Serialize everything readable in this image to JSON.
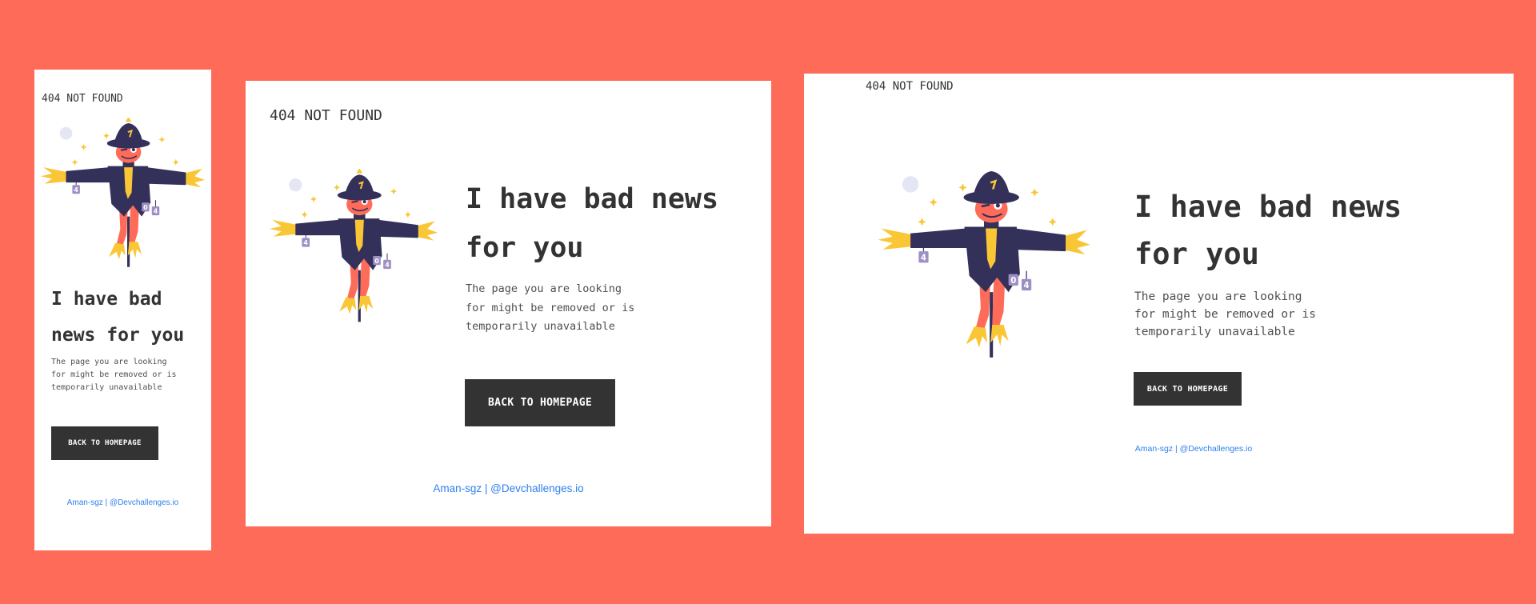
{
  "colors": {
    "background": "#ff6b59",
    "card": "#ffffff",
    "text": "#333333",
    "button": "#333333",
    "button_text": "#ffffff",
    "link": "#2f80ed"
  },
  "cards": [
    {
      "logo": "404 NOT FOUND",
      "headline_line1": "I have bad",
      "headline_line2": "news for you",
      "desc_line1": "The page you are looking",
      "desc_line2": "for might be removed or is",
      "desc_line3": "temporarily unavailable",
      "button_label": "BACK TO HOMEPAGE",
      "footer_author": "Aman-sgz",
      "footer_separator": "|",
      "footer_site": "@Devchallenges.io",
      "illustration_icon": "scarecrow-icon",
      "sign_letters": [
        "4",
        "0",
        "4"
      ]
    },
    {
      "logo": "404 NOT FOUND",
      "headline_line1": "I have bad news",
      "headline_line2": "for you",
      "desc_line1": "The page you are looking",
      "desc_line2": "for might be removed or is",
      "desc_line3": "temporarily unavailable",
      "button_label": "BACK TO HOMEPAGE",
      "footer_author": "Aman-sgz",
      "footer_separator": "|",
      "footer_site": "@Devchallenges.io",
      "illustration_icon": "scarecrow-icon",
      "sign_letters": [
        "4",
        "0",
        "4"
      ]
    },
    {
      "logo": "404 NOT FOUND",
      "headline_line1": "I have bad news",
      "headline_line2": "for you",
      "desc_line1": "The page you are looking",
      "desc_line2": "for might be removed or is",
      "desc_line3": "temporarily unavailable",
      "button_label": "BACK TO HOMEPAGE",
      "footer_author": "Aman-sgz",
      "footer_separator": "|",
      "footer_site": "@Devchallenges.io",
      "illustration_icon": "scarecrow-icon",
      "sign_letters": [
        "4",
        "0",
        "4"
      ]
    }
  ]
}
